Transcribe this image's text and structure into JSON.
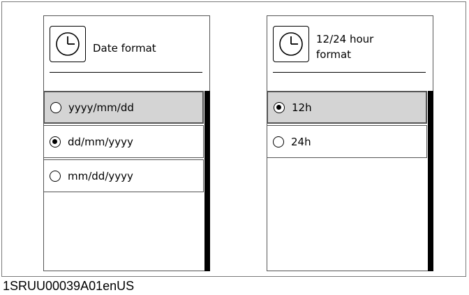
{
  "date_panel": {
    "title": "Date format",
    "icon": "clock-icon",
    "options": [
      {
        "label": "yyyy/mm/dd",
        "selected": false,
        "highlighted": true
      },
      {
        "label": "dd/mm/yyyy",
        "selected": true,
        "highlighted": false
      },
      {
        "label": "mm/dd/yyyy",
        "selected": false,
        "highlighted": false
      }
    ]
  },
  "time_panel": {
    "title": "12/24 hour format",
    "icon": "clock-icon",
    "options": [
      {
        "label": "12h",
        "selected": true,
        "highlighted": true
      },
      {
        "label": "24h",
        "selected": false,
        "highlighted": false
      }
    ]
  },
  "caption": "1SRUU00039A01enUS",
  "colors": {
    "highlight": "#d4d4d4",
    "border": "#555555",
    "scrollbar": "#000000"
  }
}
